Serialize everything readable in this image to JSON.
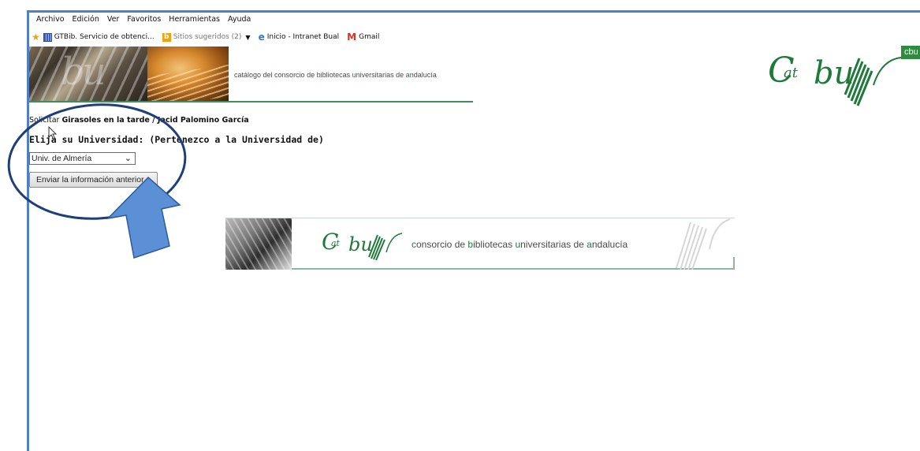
{
  "menu": [
    "Archivo",
    "Edición",
    "Ver",
    "Favoritos",
    "Herramientas",
    "Ayuda"
  ],
  "favorites": {
    "item1": "GTBib. Servicio de obtenci...",
    "item2": "Sitios sugeridos (2)",
    "item3": "Inicio - Intranet Bual",
    "item4": "Gmail"
  },
  "header": {
    "catalog_text_prefix": "catálogo del ",
    "catalog_c": "c",
    "catalog_text_mid1": "onsorcio de ",
    "catalog_b": "b",
    "catalog_text_mid2": "ibliotecas ",
    "catalog_u": "u",
    "catalog_text_mid3": "niversitarias de ",
    "catalog_a": "a",
    "catalog_text_end": "ndalucía",
    "logo_tag": "cbu"
  },
  "request": {
    "prefix": "Solicitar ",
    "title": "Girasoles en la tarde / Jacid Palomino García"
  },
  "form": {
    "prompt": "Elija su Universidad: (Pertenezco a la Universidad de)",
    "selected_university": "Univ. de Almería",
    "submit_label": "Enviar la información anterior"
  },
  "footer": {
    "text_c": "c",
    "text_mid1": "onsorcio de ",
    "text_b": "b",
    "text_mid2": "ibliotecas ",
    "text_u": "u",
    "text_mid3": "niversitarias de ",
    "text_a": "a",
    "text_end": "ndalucía"
  },
  "colors": {
    "frame_blue": "#4f7fc4",
    "brand_green": "#1f7a3a",
    "annotation_blue": "#1f3f7a",
    "arrow_fill": "#5b8fd6"
  }
}
